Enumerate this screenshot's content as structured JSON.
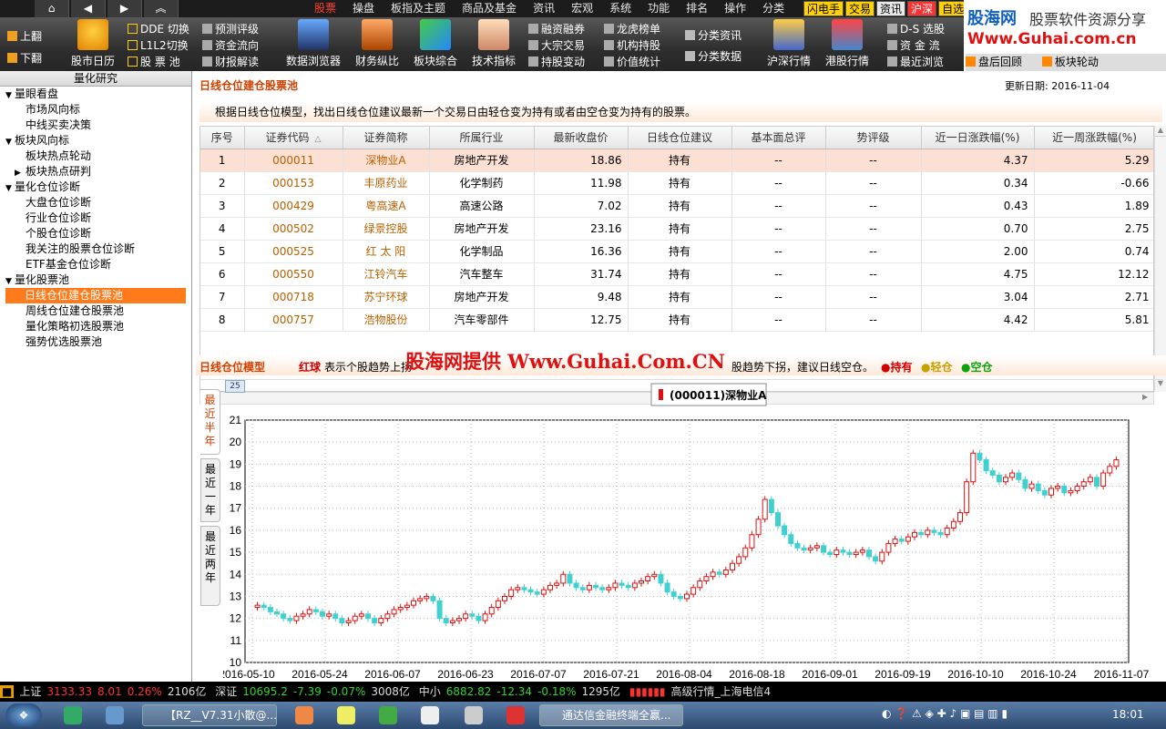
{
  "menubar": {
    "items": [
      "股票",
      "操盘",
      "板指及主题",
      "商品及基金",
      "资讯",
      "宏观",
      "系统",
      "功能",
      "排名",
      "操作",
      "分类"
    ],
    "active": "股票",
    "quick": [
      {
        "label": "闪电手",
        "bg": "#ffd200",
        "color": "#000"
      },
      {
        "label": "交易",
        "bg": "#ffd200",
        "color": "#000"
      },
      {
        "label": "资讯",
        "bg": "#e8e8e8",
        "color": "#000"
      },
      {
        "label": "沪深",
        "bg": "#ff3030",
        "color": "#fff"
      },
      {
        "label": "自选",
        "bg": "#ffd200",
        "color": "#000"
      }
    ]
  },
  "brand": {
    "line1": "股海网",
    "line2": "股票软件资源分享",
    "url": "Www.Guhai.com.cn"
  },
  "toolbar": {
    "pageup": "上翻",
    "pagedown": "下翻",
    "calendar": "股市日历",
    "dde": "DDE 切换",
    "l1l2": "L1L2切换",
    "stockpool": "股 票 池",
    "forecast": "预测评级",
    "capital_flow": "资金流向",
    "financial": "财报解读",
    "data_browser": "数据浏览器",
    "fin_compare": "财务纵比",
    "sector_overview": "板块综合",
    "tech_indicator": "技术指标",
    "margin": "融资融券",
    "block_trade": "大宗交易",
    "holding_change": "持股变动",
    "dragon_tiger": "龙虎榜单",
    "inst_holding": "机构持股",
    "value_stats": "价值统计",
    "cat_news": "分类资讯",
    "cat_data": "分类数据",
    "shsz_quotes": "沪深行情",
    "hk_quotes": "港股行情",
    "ds_select": "D-S 选股",
    "capital": "资 金 流",
    "recent_browse": "最近浏览",
    "review": "盘后回顾",
    "sector_rotation": "板块轮动"
  },
  "left": {
    "header": "量化研究",
    "tree": [
      {
        "label": "量眼看盘",
        "level": 0,
        "expander": "▼"
      },
      {
        "label": "市场风向标",
        "level": 1
      },
      {
        "label": "中线买卖决策",
        "level": 1
      },
      {
        "label": "板块风向标",
        "level": 0,
        "expander": "▼"
      },
      {
        "label": "板块热点轮动",
        "level": 1
      },
      {
        "label": "板块热点研判",
        "level": 1,
        "expander": "▶"
      },
      {
        "label": "量化仓位诊断",
        "level": 0,
        "expander": "▼"
      },
      {
        "label": "大盘仓位诊断",
        "level": 1
      },
      {
        "label": "行业仓位诊断",
        "level": 1
      },
      {
        "label": "个股仓位诊断",
        "level": 1
      },
      {
        "label": "我关注的股票仓位诊断",
        "level": 1
      },
      {
        "label": "ETF基金仓位诊断",
        "level": 1
      },
      {
        "label": "量化股票池",
        "level": 0,
        "expander": "▼"
      },
      {
        "label": "日线仓位建仓股票池",
        "level": 1,
        "selected": true
      },
      {
        "label": "周线仓位建仓股票池",
        "level": 1
      },
      {
        "label": "量化策略初选股票池",
        "level": 1
      },
      {
        "label": "强势优选股票池",
        "level": 1
      }
    ]
  },
  "main": {
    "title": "日线仓位建仓股票池",
    "update": "更新日期: 2016-11-04",
    "desc": "根据日线仓位模型，找出日线仓位建议最新一个交易日由轻仓变为持有或者由空仓变为持有的股票。",
    "columns": [
      "序号",
      "证券代码",
      "证券简称",
      "所属行业",
      "最新收盘价",
      "日线仓位建议",
      "基本面总评",
      "势评级",
      "近一日涨跌幅(%)",
      "近一周涨跌幅(%)"
    ],
    "sort_mark": "△",
    "rows": [
      [
        "1",
        "000011",
        "深物业A",
        "房地产开发",
        "18.86",
        "持有",
        "--",
        "--",
        "4.37",
        "5.29"
      ],
      [
        "2",
        "000153",
        "丰原药业",
        "化学制药",
        "11.98",
        "持有",
        "--",
        "--",
        "0.34",
        "-0.66"
      ],
      [
        "3",
        "000429",
        "粤高速A",
        "高速公路",
        "7.02",
        "持有",
        "--",
        "--",
        "0.43",
        "1.89"
      ],
      [
        "4",
        "000502",
        "绿景控股",
        "房地产开发",
        "23.16",
        "持有",
        "--",
        "--",
        "0.70",
        "2.75"
      ],
      [
        "5",
        "000525",
        "红 太 阳",
        "化学制品",
        "16.36",
        "持有",
        "--",
        "--",
        "2.00",
        "0.74"
      ],
      [
        "6",
        "000550",
        "江铃汽车",
        "汽车整车",
        "31.74",
        "持有",
        "--",
        "--",
        "4.75",
        "12.12"
      ],
      [
        "7",
        "000718",
        "苏宁环球",
        "房地产开发",
        "9.48",
        "持有",
        "--",
        "--",
        "3.04",
        "2.71"
      ],
      [
        "8",
        "000757",
        "浩物股份",
        "汽车零部件",
        "12.75",
        "持有",
        "--",
        "--",
        "4.42",
        "5.81"
      ]
    ],
    "model_title": "日线仓位模型",
    "model_red": "红球",
    "model_text1": "表示个股趋势上扬",
    "model_text2": "股趋势下拐，建议日线空仓。",
    "legend": [
      "●持有",
      "●轻仓",
      "●空仓"
    ],
    "watermark": "股海网提供 Www.Guhai.Com.CN",
    "tabs": [
      "最近半年",
      "最近一年",
      "最近两年"
    ],
    "corner_label": "25"
  },
  "chart_data": {
    "type": "candlestick",
    "legend": "(000011)深物业A",
    "ylim": [
      10,
      21
    ],
    "yticks": [
      10,
      11,
      12,
      13,
      14,
      15,
      16,
      17,
      18,
      19,
      20,
      21
    ],
    "xticks": [
      "2016-05-10",
      "2016-05-24",
      "2016-06-07",
      "2016-06-23",
      "2016-07-07",
      "2016-07-21",
      "2016-08-04",
      "2016-08-18",
      "2016-09-01",
      "2016-09-19",
      "2016-10-10",
      "2016-10-24",
      "2016-11-07"
    ],
    "up_color": "#e01010",
    "down_color": "#40d0d0",
    "close": [
      12.6,
      12.5,
      12.3,
      12.2,
      12.0,
      11.9,
      12.1,
      12.2,
      12.4,
      12.3,
      12.1,
      12.2,
      12.0,
      11.8,
      11.9,
      12.1,
      12.2,
      12.0,
      11.8,
      12.0,
      12.2,
      12.4,
      12.5,
      12.6,
      12.8,
      12.9,
      13.0,
      12.8,
      12.0,
      11.8,
      11.9,
      12.0,
      12.2,
      12.1,
      11.9,
      12.2,
      12.5,
      12.8,
      13.0,
      13.3,
      13.4,
      13.3,
      13.2,
      13.1,
      13.3,
      13.5,
      13.6,
      14.0,
      13.6,
      13.4,
      13.3,
      13.5,
      13.4,
      13.3,
      13.4,
      13.6,
      13.5,
      13.4,
      13.6,
      13.7,
      13.9,
      14.0,
      13.6,
      13.2,
      13.0,
      12.9,
      13.1,
      13.4,
      13.7,
      13.9,
      14.1,
      14.0,
      14.2,
      14.5,
      14.8,
      15.2,
      15.8,
      16.5,
      17.4,
      16.8,
      16.2,
      15.8,
      15.4,
      15.2,
      15.1,
      15.2,
      15.3,
      15.0,
      14.9,
      15.1,
      15.0,
      14.9,
      15.0,
      15.1,
      14.8,
      14.6,
      15.0,
      15.4,
      15.6,
      15.5,
      15.7,
      15.9,
      15.8,
      16.0,
      15.9,
      15.8,
      16.1,
      16.4,
      16.8,
      18.2,
      19.5,
      19.2,
      18.7,
      18.5,
      18.2,
      18.4,
      18.6,
      18.3,
      17.9,
      18.1,
      17.8,
      17.6,
      17.9,
      18.0,
      17.7,
      17.8,
      18.0,
      18.2,
      18.4,
      18.0,
      18.6,
      18.9,
      19.2
    ]
  }
}
